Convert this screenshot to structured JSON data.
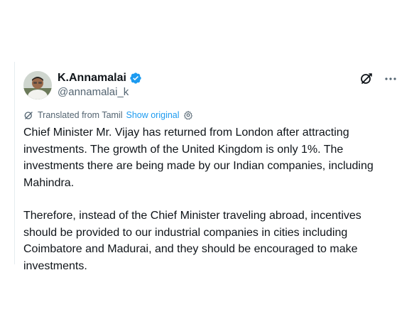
{
  "author": {
    "display_name": "K.Annamalai",
    "handle": "@annamalai_k",
    "verified": true,
    "verified_color": "#1d9bf0"
  },
  "icons": {
    "verified": "verified-badge-icon",
    "grok": "grok-icon",
    "more": "more-icon",
    "translate": "translate-icon",
    "settings": "gear-icon"
  },
  "translation": {
    "label": "Translated from Tamil",
    "show_original": "Show original"
  },
  "tweet": {
    "paragraphs": [
      "Chief Minister Mr. Vijay has returned from London after attracting investments. The growth of the United Kingdom is only 1%. The investments there are being made by our Indian companies, including Mahindra.",
      "Therefore, instead of the Chief Minister traveling abroad, incentives should be provided to our industrial companies in cities including Coimbatore and Madurai, and they should be encouraged to make investments."
    ]
  },
  "colors": {
    "text_primary": "#0f1419",
    "text_secondary": "#536471",
    "accent": "#1d9bf0"
  }
}
